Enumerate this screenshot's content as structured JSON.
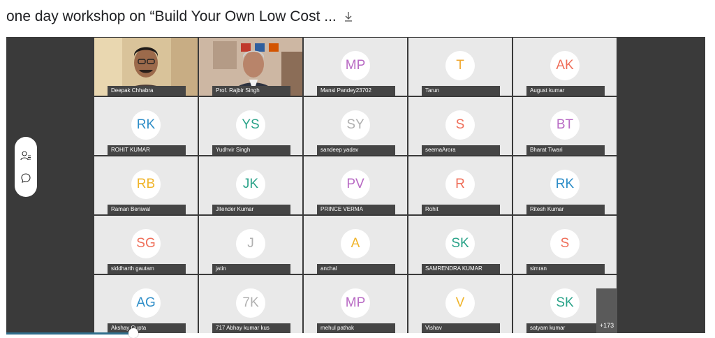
{
  "header": {
    "title": "one day workshop on “Build Your Own Low Cost ...",
    "download_icon": "download-icon"
  },
  "side_rail": {
    "participants_icon": "participants-icon",
    "chat_icon": "chat-icon"
  },
  "participants": [
    {
      "name": "Deepak Chhabra",
      "initials": "",
      "video": true,
      "color": ""
    },
    {
      "name": "Prof. Rajbir Singh",
      "initials": "",
      "video": true,
      "color": ""
    },
    {
      "name": "Mansi Pandey23702",
      "initials": "MP",
      "video": false,
      "color": "#b86ac4"
    },
    {
      "name": "Tarun",
      "initials": "T",
      "video": false,
      "color": "#f0a832"
    },
    {
      "name": "August kumar",
      "initials": "AK",
      "video": false,
      "color": "#ef6f5a"
    },
    {
      "name": "ROHIT KUMAR",
      "initials": "RK",
      "video": false,
      "color": "#2f8ec8"
    },
    {
      "name": "Yudhvir Singh",
      "initials": "YS",
      "video": false,
      "color": "#2aa389"
    },
    {
      "name": "sandeep yadav",
      "initials": "SY",
      "video": false,
      "color": "#b0b0b0"
    },
    {
      "name": "seemaArora",
      "initials": "S",
      "video": false,
      "color": "#ef6f5a"
    },
    {
      "name": "Bharat Tiwari",
      "initials": "BT",
      "video": false,
      "color": "#b86ac4"
    },
    {
      "name": "Raman Beniwal",
      "initials": "RB",
      "video": false,
      "color": "#f0b42a"
    },
    {
      "name": "Jitender Kumar",
      "initials": "JK",
      "video": false,
      "color": "#2aa389"
    },
    {
      "name": "PRINCE VERMA",
      "initials": "PV",
      "video": false,
      "color": "#b86ac4"
    },
    {
      "name": "Rohit",
      "initials": "R",
      "video": false,
      "color": "#ef6f5a"
    },
    {
      "name": "Ritesh Kumar",
      "initials": "RK",
      "video": false,
      "color": "#2f8ec8"
    },
    {
      "name": "siddharth gautam",
      "initials": "SG",
      "video": false,
      "color": "#ef6f5a"
    },
    {
      "name": "jatin",
      "initials": "J",
      "video": false,
      "color": "#b0b0b0"
    },
    {
      "name": "anchal",
      "initials": "A",
      "video": false,
      "color": "#f0b42a"
    },
    {
      "name": "SAMRENDRA KUMAR",
      "initials": "SK",
      "video": false,
      "color": "#2aa389"
    },
    {
      "name": "simran",
      "initials": "S",
      "video": false,
      "color": "#ef6f5a"
    },
    {
      "name": "Akshay Gupta",
      "initials": "AG",
      "video": false,
      "color": "#2f8ec8"
    },
    {
      "name": "717 Abhay kumar kus",
      "initials": "7K",
      "video": false,
      "color": "#b0b0b0"
    },
    {
      "name": "mehul pathak",
      "initials": "MP",
      "video": false,
      "color": "#b86ac4"
    },
    {
      "name": "Vishav",
      "initials": "V",
      "video": false,
      "color": "#f0b42a"
    },
    {
      "name": "satyam kumar",
      "initials": "SK",
      "video": false,
      "color": "#2aa389"
    }
  ],
  "more_count": "+173"
}
